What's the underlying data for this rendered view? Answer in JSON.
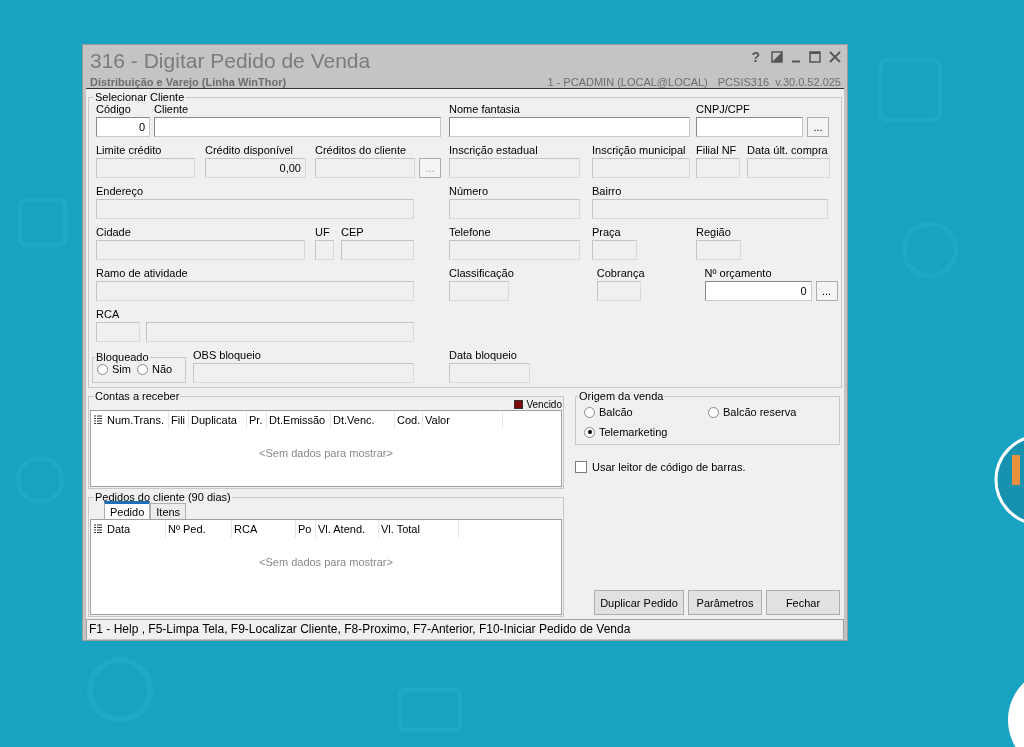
{
  "window": {
    "title": "316 - Digitar Pedido de Venda",
    "subtitle": "Distribuição e Varejo (Linha WinThor)",
    "user": "1 - PCADMIN (LOCAL@LOCAL)",
    "program": "PCSIS316",
    "version": "v.30.0.52.025",
    "help": "?"
  },
  "client": {
    "title": "Selecionar Cliente",
    "rows": [
      {
        "items": [
          {
            "kind": "field",
            "label": "Código",
            "value": "0",
            "disabled": false
          },
          {
            "kind": "field",
            "label": "Cliente",
            "disabled": false
          },
          {
            "kind": "field",
            "label": "Nome fantasia",
            "disabled": false
          },
          {
            "kind": "field",
            "label": "CNPJ/CPF",
            "disabled": false,
            "lookup": {
              "text": "...",
              "disabled": false
            }
          }
        ]
      },
      {
        "items": [
          {
            "kind": "field",
            "label": "Limite crédito",
            "disabled": true
          },
          {
            "kind": "field",
            "label": "Crédito disponível",
            "value": "0,00",
            "disabled": true
          },
          {
            "kind": "field",
            "label": "Créditos do cliente",
            "disabled": true,
            "lookup": {
              "text": "...",
              "disabled": true
            }
          },
          {
            "kind": "field",
            "label": "Inscrição estadual",
            "disabled": true
          },
          {
            "kind": "field",
            "label": "Inscrição municipal",
            "disabled": true
          },
          {
            "kind": "field",
            "label": "Filial NF",
            "disabled": true
          },
          {
            "kind": "field",
            "label": "Data últ. compra",
            "disabled": true
          }
        ]
      },
      {
        "items": [
          {
            "kind": "field",
            "label": "Endereço",
            "disabled": true
          },
          {
            "kind": "field",
            "label": "Número",
            "disabled": true
          },
          {
            "kind": "field",
            "label": "Bairro",
            "disabled": true
          }
        ]
      },
      {
        "items": [
          {
            "kind": "field",
            "label": "Cidade",
            "disabled": true
          },
          {
            "kind": "field",
            "label": "UF",
            "disabled": true
          },
          {
            "kind": "field",
            "label": "CEP",
            "disabled": true
          },
          {
            "kind": "field",
            "label": "Telefone",
            "disabled": true
          },
          {
            "kind": "field",
            "label": "Praça",
            "disabled": true
          },
          {
            "kind": "field",
            "label": "Região",
            "disabled": true
          }
        ]
      },
      {
        "items": [
          {
            "kind": "field",
            "label": "Ramo de atividade",
            "disabled": true
          },
          {
            "kind": "field",
            "label": "Classificação",
            "disabled": true
          },
          {
            "kind": "field",
            "label": "Cobrança",
            "disabled": true
          },
          {
            "kind": "field",
            "label": "Nº orçamento",
            "value": "0",
            "disabled": false,
            "lookup": {
              "text": "...",
              "disabled": false
            }
          }
        ]
      },
      {
        "items": [
          {
            "kind": "field",
            "label": "RCA",
            "disabled": true
          },
          {
            "kind": "field",
            "disabled": true
          }
        ]
      },
      {
        "items": [
          {
            "kind": "radios",
            "title": "Bloqueado",
            "options": [
              {
                "label": "Sim",
                "selected": false
              },
              {
                "label": "Não",
                "selected": false
              }
            ]
          },
          {
            "kind": "field",
            "label": "OBS bloqueio",
            "disabled": true
          },
          {
            "kind": "field",
            "label": "Data bloqueio",
            "disabled": true
          }
        ]
      }
    ]
  },
  "receivables": {
    "title": "Contas a receber",
    "legend": {
      "label": "Vencido",
      "color": "#7a0a0a"
    },
    "columns": [
      "Num.Trans.",
      "Fili",
      "Duplicata",
      "Pr.",
      "Dt.Emissão",
      "Dt.Venc.",
      "Cod.",
      "Valor"
    ],
    "empty": "<Sem dados para mostrar>"
  },
  "orders": {
    "title": "Pedidos do cliente (90 dias)",
    "tabs": [
      {
        "label": "Pedido",
        "selected": true
      },
      {
        "label": "Itens",
        "selected": false
      }
    ],
    "columns": [
      "Data",
      "Nº Ped.",
      "RCA",
      "Po",
      "Vl. Atend.",
      "Vl. Total"
    ],
    "empty": "<Sem dados para mostrar>"
  },
  "origin": {
    "title": "Origem da venda",
    "options": [
      {
        "label": "Balcão",
        "selected": false
      },
      {
        "label": "Balcão reserva",
        "selected": false
      },
      {
        "label": "Telemarketing",
        "selected": true
      }
    ]
  },
  "barcode": {
    "label": "Usar leitor de código de barras.",
    "checked": false
  },
  "buttons": [
    "Duplicar Pedido",
    "Parâmetros",
    "Fechar"
  ],
  "status_bar": "F1 - Help , F5-Limpa Tela, F9-Localizar Cliente, F8-Proximo, F7-Anterior, F10-Iniciar Pedido de Venda"
}
